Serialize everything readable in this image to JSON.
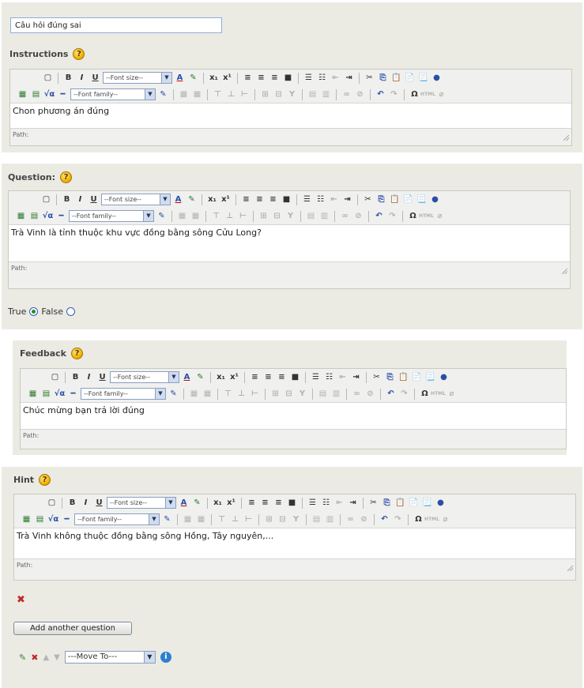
{
  "question_name": "Câu hỏi đúng sai",
  "toolbar": {
    "font_size": "--Font size--",
    "font_family": "--Font family--",
    "path_label": "Path:"
  },
  "instructions": {
    "label": "Instructions",
    "content": "Chon phương án đúng"
  },
  "question": {
    "label": "Question:",
    "content": "Trà Vinh là tỉnh thuộc khu vực đồng bằng sông Cửu Long?",
    "true_label": "True",
    "false_label": "False",
    "selected": "True"
  },
  "feedback": {
    "label": "Feedback",
    "content": "Chúc mừng bạn trả lời đúng"
  },
  "hint": {
    "label": "Hint",
    "content": "Trà Vinh không thuộc đồng bằng sông Hồng, Tây nguyên,..."
  },
  "actions": {
    "add_question": "Add another question",
    "move_to": "---Move To---"
  },
  "colors": {
    "panel_bg": "#ebebe4",
    "input_border": "#8faed6"
  }
}
